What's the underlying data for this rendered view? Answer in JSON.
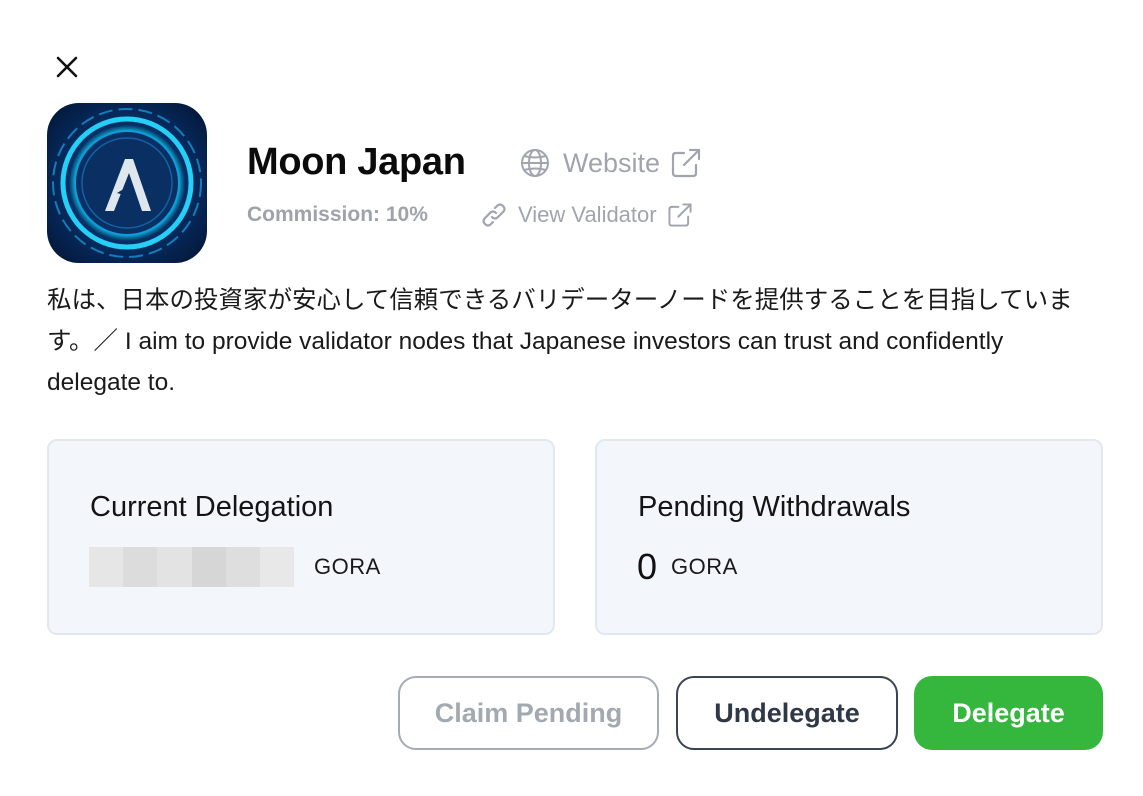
{
  "validator": {
    "name": "Moon Japan",
    "website_label": "Website",
    "commission_label": "Commission: 10%",
    "view_validator_label": "View Validator",
    "logo_icon": "algorand-logo-icon",
    "description": "私は、日本の投資家が安心して信頼できるバリデーターノードを提供することを目指しています。／ I aim to provide validator nodes that Japanese investors can trust and confidently delegate to."
  },
  "cards": {
    "current_delegation": {
      "title": "Current Delegation",
      "unit": "GORA"
    },
    "pending_withdrawals": {
      "title": "Pending Withdrawals",
      "value": "0",
      "unit": "GORA"
    }
  },
  "buttons": {
    "claim_pending": "Claim Pending",
    "undelegate": "Undelegate",
    "delegate": "Delegate"
  },
  "colors": {
    "delegate_green": "#35b73e",
    "card_bg": "#f3f7fb",
    "muted_text": "#a0a5ad"
  }
}
